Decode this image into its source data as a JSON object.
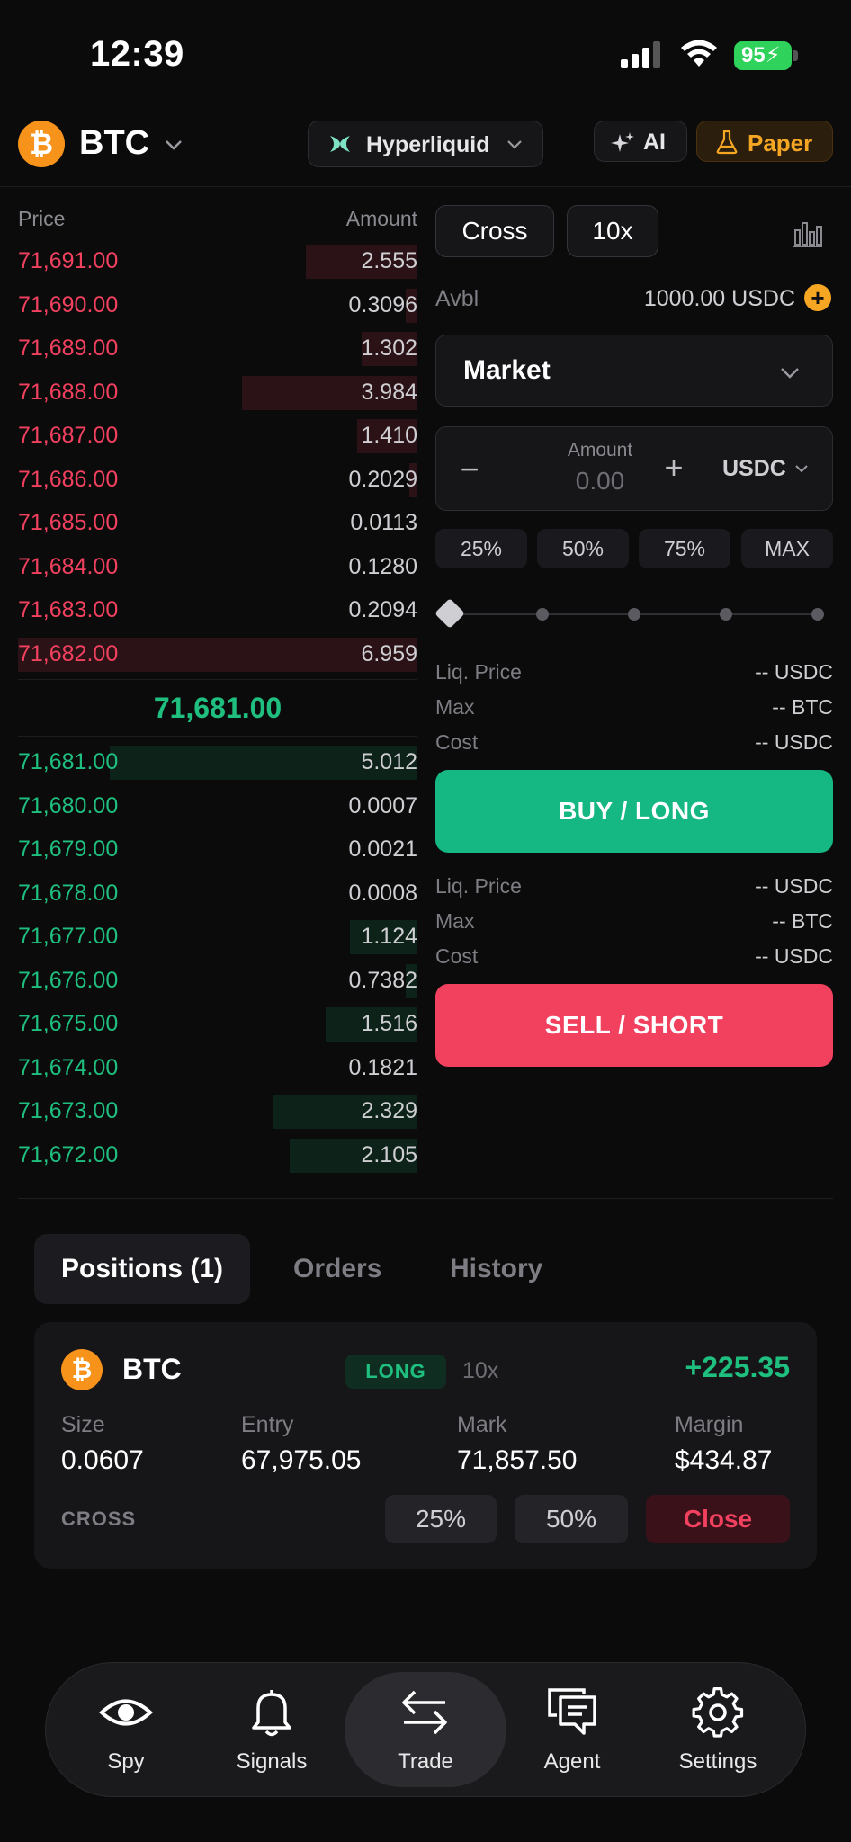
{
  "status_bar": {
    "time": "12:39",
    "battery": "95"
  },
  "header": {
    "coin": "BTC",
    "exchange": "Hyperliquid",
    "ai_label": "AI",
    "paper_label": "Paper"
  },
  "orderbook": {
    "price_header": "Price",
    "amount_header": "Amount",
    "asks": [
      {
        "price": "71,691.00",
        "amount": "2.555",
        "depth": 0.28
      },
      {
        "price": "71,690.00",
        "amount": "0.3096",
        "depth": 0.03
      },
      {
        "price": "71,689.00",
        "amount": "1.302",
        "depth": 0.14
      },
      {
        "price": "71,688.00",
        "amount": "3.984",
        "depth": 0.44
      },
      {
        "price": "71,687.00",
        "amount": "1.410",
        "depth": 0.15
      },
      {
        "price": "71,686.00",
        "amount": "0.2029",
        "depth": 0.02
      },
      {
        "price": "71,685.00",
        "amount": "0.0113",
        "depth": 0.0
      },
      {
        "price": "71,684.00",
        "amount": "0.1280",
        "depth": 0.0
      },
      {
        "price": "71,683.00",
        "amount": "0.2094",
        "depth": 0.0
      },
      {
        "price": "71,682.00",
        "amount": "6.959",
        "depth": 1.0
      }
    ],
    "mid_price": "71,681.00",
    "bids": [
      {
        "price": "71,681.00",
        "amount": "5.012",
        "depth": 0.77
      },
      {
        "price": "71,680.00",
        "amount": "0.0007",
        "depth": 0.0
      },
      {
        "price": "71,679.00",
        "amount": "0.0021",
        "depth": 0.0
      },
      {
        "price": "71,678.00",
        "amount": "0.0008",
        "depth": 0.0
      },
      {
        "price": "71,677.00",
        "amount": "1.124",
        "depth": 0.17
      },
      {
        "price": "71,676.00",
        "amount": "0.7382",
        "depth": 0.03
      },
      {
        "price": "71,675.00",
        "amount": "1.516",
        "depth": 0.23
      },
      {
        "price": "71,674.00",
        "amount": "0.1821",
        "depth": 0.0
      },
      {
        "price": "71,673.00",
        "amount": "2.329",
        "depth": 0.36
      },
      {
        "price": "71,672.00",
        "amount": "2.105",
        "depth": 0.32
      }
    ]
  },
  "trade_panel": {
    "margin_mode": "Cross",
    "leverage": "10x",
    "avbl_label": "Avbl",
    "avbl_value": "1000.00 USDC",
    "order_type": "Market",
    "amount_label": "Amount",
    "amount_placeholder": "0.00",
    "amount_unit": "USDC",
    "percent_buttons": [
      "25%",
      "50%",
      "75%",
      "MAX"
    ],
    "slider_value": 0,
    "buy_info": [
      {
        "label": "Liq. Price",
        "value": "-- USDC"
      },
      {
        "label": "Max",
        "value": "-- BTC"
      },
      {
        "label": "Cost",
        "value": "-- USDC"
      }
    ],
    "buy_label": "BUY / LONG",
    "sell_info": [
      {
        "label": "Liq. Price",
        "value": "-- USDC"
      },
      {
        "label": "Max",
        "value": "-- BTC"
      },
      {
        "label": "Cost",
        "value": "-- USDC"
      }
    ],
    "sell_label": "SELL / SHORT"
  },
  "tabs": [
    "Positions (1)",
    "Orders",
    "History"
  ],
  "position": {
    "symbol": "BTC",
    "side": "LONG",
    "leverage": "10x",
    "pnl": "+225.35",
    "fields": [
      {
        "label": "Size",
        "value": "0.0607"
      },
      {
        "label": "Entry",
        "value": "67,975.05"
      },
      {
        "label": "Mark",
        "value": "71,857.50"
      },
      {
        "label": "Margin",
        "value": "$434.87"
      }
    ],
    "margin_type": "CROSS",
    "btn_25": "25%",
    "btn_50": "50%",
    "close_label": "Close"
  },
  "nav": {
    "items": [
      {
        "label": "Spy",
        "icon": "eye-icon"
      },
      {
        "label": "Signals",
        "icon": "bell-icon"
      },
      {
        "label": "Trade",
        "icon": "swap-icon"
      },
      {
        "label": "Agent",
        "icon": "chat-icon"
      },
      {
        "label": "Settings",
        "icon": "gear-icon"
      }
    ],
    "active": "Trade"
  },
  "colors": {
    "bg": "#0b0b0c",
    "green": "#1fbf7f",
    "red": "#f2415f",
    "orange": "#f5a623",
    "buy_button": "#15b883",
    "sell_button": "#f2405f"
  }
}
